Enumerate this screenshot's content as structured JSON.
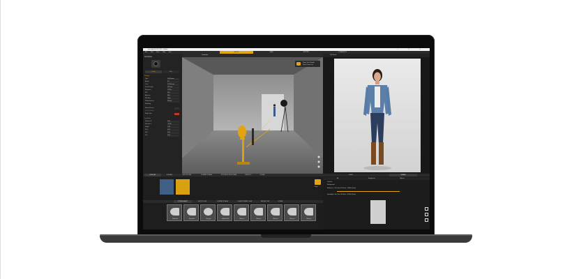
{
  "app": {
    "title": "set.a.light 3D V2.5 SN - Untitled",
    "window_controls": [
      "—",
      "☐",
      "✕"
    ]
  },
  "menu": {
    "items": [
      "File",
      "Edit",
      "View",
      "Help",
      "Info"
    ]
  },
  "main_tabs": [
    {
      "label": "SETUP",
      "active": true
    },
    {
      "label": "VIEW",
      "active": false
    },
    {
      "label": "EXPORT",
      "active": false
    },
    {
      "label": "COMMUNITY",
      "active": false
    }
  ],
  "left_panel": {
    "header": "Camera",
    "modes": [
      {
        "label": "Photo",
        "active": true
      },
      {
        "label": "Film",
        "active": false
      }
    ],
    "settings_section": "Settings",
    "fields": [
      {
        "key": "Type",
        "value": "Full Frame"
      },
      {
        "key": "Aspect",
        "value": "3:2"
      },
      {
        "key": "Lens",
        "value": "70-200 mm"
      },
      {
        "key": "Focal Length",
        "value": "135 mm"
      },
      {
        "key": "Exposure",
        "value": "1/125 s"
      },
      {
        "key": "ISO",
        "value": "100"
      },
      {
        "key": "Aperture",
        "value": "f/8.0"
      },
      {
        "key": "ND Filter",
        "value": "None"
      },
      {
        "key": "White Balance",
        "value": "5500 K"
      },
      {
        "key": "Modeling",
        "value": ""
      }
    ],
    "manual_focus": "Manual Focus",
    "focal_distance": "Focal Distance",
    "body_color": "Body Color",
    "transform_section": "Transform",
    "transform_fields": [
      {
        "key": "Rotation X",
        "value": "0.00"
      },
      {
        "key": "Rotation Y",
        "value": "-12.00"
      },
      {
        "key": "Height",
        "value": "1.45"
      },
      {
        "key": "Pitch",
        "value": "0.00"
      },
      {
        "key": "Roll",
        "value": "0.00"
      },
      {
        "key": "Pan",
        "value": "0.00"
      }
    ]
  },
  "viewport": {
    "toolbar_label": "Studiolight",
    "overlay_1": "Show Test Shadow",
    "overlay_2": "Open Preset List"
  },
  "right_panel": {
    "toolbar_label": "Full Frame",
    "scene_tabs": [
      "LIGHT",
      "SCENE"
    ],
    "columns": [
      "All",
      "Equipment",
      "Objects"
    ],
    "list": [
      "Camera",
      "Background",
      "Reflector 1 - Bi Color 5K Flash - 250Ws (flash)",
      "Speedlight - Bi Color 5K Flash - 250Ws (flash)"
    ]
  },
  "bottom": {
    "tabs_top": [
      "FOR LIST",
      "SCENES",
      "SHOOTLIGHT",
      "COMPACTFLASH",
      "STROBOSCOPE FLASH",
      "REFLECT",
      "OTHER"
    ],
    "capture_label": "Snap",
    "tabs_library": [
      "STUDIOLIGHT",
      "SHOOTLIGHT",
      "COMPACTFLASH",
      "LIGHTFORMER LIGHT",
      "REFLECTOR",
      "OTHER"
    ],
    "lights": [
      "Studio Flash",
      "Beauty Dish",
      "Ring Light",
      "Softbox 30x120",
      "Reflector 1",
      "Reflector 2",
      "Reflector 3",
      "Reflector 4",
      "Reflector 5"
    ]
  },
  "colors": {
    "accent": "#e2a412",
    "ui_dark": "#1b1b1b"
  }
}
